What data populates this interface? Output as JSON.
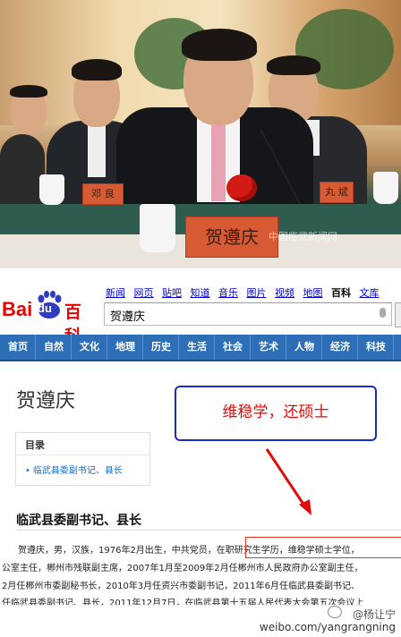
{
  "photo": {
    "namecard_main": "贺遵庆",
    "namecard_left": "邓 良",
    "namecard_right": "丸 斌",
    "watermark": "中国临武新闻网"
  },
  "baidu": {
    "logo_bai": "Bai",
    "logo_du": "du",
    "logo_baike": "百科",
    "topnav": [
      "新闻",
      "网页",
      "贴吧",
      "知道",
      "音乐",
      "图片",
      "视频",
      "地图",
      "百科",
      "文库"
    ],
    "search_value": "贺遵庆",
    "categories": [
      "首页",
      "自然",
      "文化",
      "地理",
      "历史",
      "生活",
      "社会",
      "艺术",
      "人物",
      "经济",
      "科技"
    ],
    "entry_title": "贺遵庆",
    "toc_heading": "目录",
    "toc_item": "临武县委副书记、县长",
    "section_title": "临武县委副书记、县长",
    "para_lines": [
      "贺遵庆，男，汉族，1976年2月出生，中共党员，在职研究生学历，维稳学硕士学位，",
      "公室主任，郴州市残联副主席，2007年1月至2009年2月任郴州市人民政府办公室副主任，",
      "2月任郴州市委副秘书长，2010年3月任资兴市委副书记，2011年6月任临武县委副书记、",
      "任临武县委副书记、县长，2011年12月7日，在临武县第十五届人民代表大会第五次会议上"
    ]
  },
  "annotation": "维稳学，还硕士",
  "footer": {
    "weibo_name": "@杨让宁",
    "weibo_url": "weibo.com/yangrangning"
  },
  "colors": {
    "baidu_red": "#e10602",
    "category_bar": "#2d6eb6",
    "link": "#136ec2",
    "annotation_border": "#1b2cc2",
    "annotation_text": "#e10a0a"
  }
}
